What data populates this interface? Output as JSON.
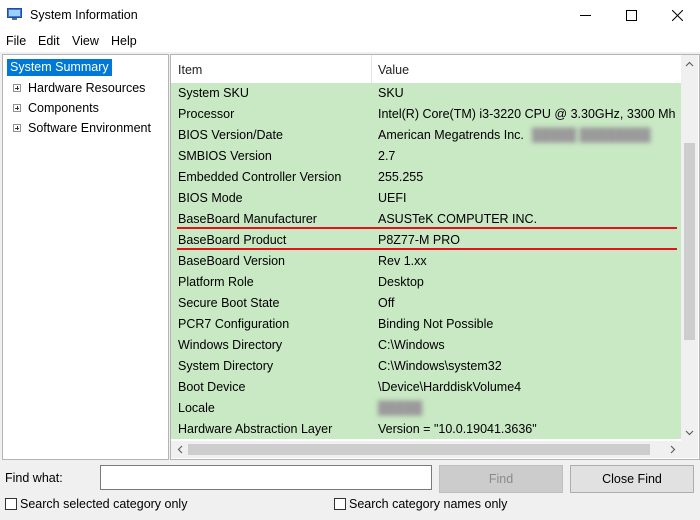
{
  "window": {
    "title": "System Information",
    "icon": "system-information-app-icon",
    "controls": [
      "minimize-icon",
      "maximize-icon",
      "close-icon"
    ]
  },
  "menu": [
    "File",
    "Edit",
    "View",
    "Help"
  ],
  "tree": {
    "selected": "System Summary",
    "children": [
      "Hardware Resources",
      "Components",
      "Software Environment"
    ]
  },
  "list": {
    "headers": {
      "item": "Item",
      "value": "Value"
    },
    "rows": [
      {
        "item": "System SKU",
        "value": "SKU"
      },
      {
        "item": "Processor",
        "value": "Intel(R) Core(TM) i3-3220 CPU @ 3.30GHz, 3300 Mh"
      },
      {
        "item": "BIOS Version/Date",
        "value": "American Megatrends Inc."
      },
      {
        "item": "SMBIOS Version",
        "value": "2.7"
      },
      {
        "item": "Embedded Controller Version",
        "value": "255.255"
      },
      {
        "item": "BIOS Mode",
        "value": "UEFI"
      },
      {
        "item": "BaseBoard Manufacturer",
        "value": "ASUSTeK COMPUTER INC."
      },
      {
        "item": "BaseBoard Product",
        "value": "P8Z77-M PRO"
      },
      {
        "item": "BaseBoard Version",
        "value": "Rev 1.xx"
      },
      {
        "item": "Platform Role",
        "value": "Desktop"
      },
      {
        "item": "Secure Boot State",
        "value": "Off"
      },
      {
        "item": "PCR7 Configuration",
        "value": "Binding Not Possible"
      },
      {
        "item": "Windows Directory",
        "value": "C:\\Windows"
      },
      {
        "item": "System Directory",
        "value": "C:\\Windows\\system32"
      },
      {
        "item": "Boot Device",
        "value": "\\Device\\HarddiskVolume4"
      },
      {
        "item": "Locale",
        "value": ""
      },
      {
        "item": "Hardware Abstraction Layer",
        "value": "Version = \"10.0.19041.3636\""
      }
    ],
    "highlighted_rows": [
      "BaseBoard Manufacturer",
      "BaseBoard Product"
    ]
  },
  "find": {
    "label": "Find what:",
    "value": "",
    "find_button": "Find",
    "close_button": "Close Find",
    "search_selected_label": "Search selected category only",
    "search_names_label": "Search category names only"
  },
  "colors": {
    "selection": "#0078d7",
    "row_background": "#c9e8c4",
    "annotation_line": "#e8101a"
  }
}
